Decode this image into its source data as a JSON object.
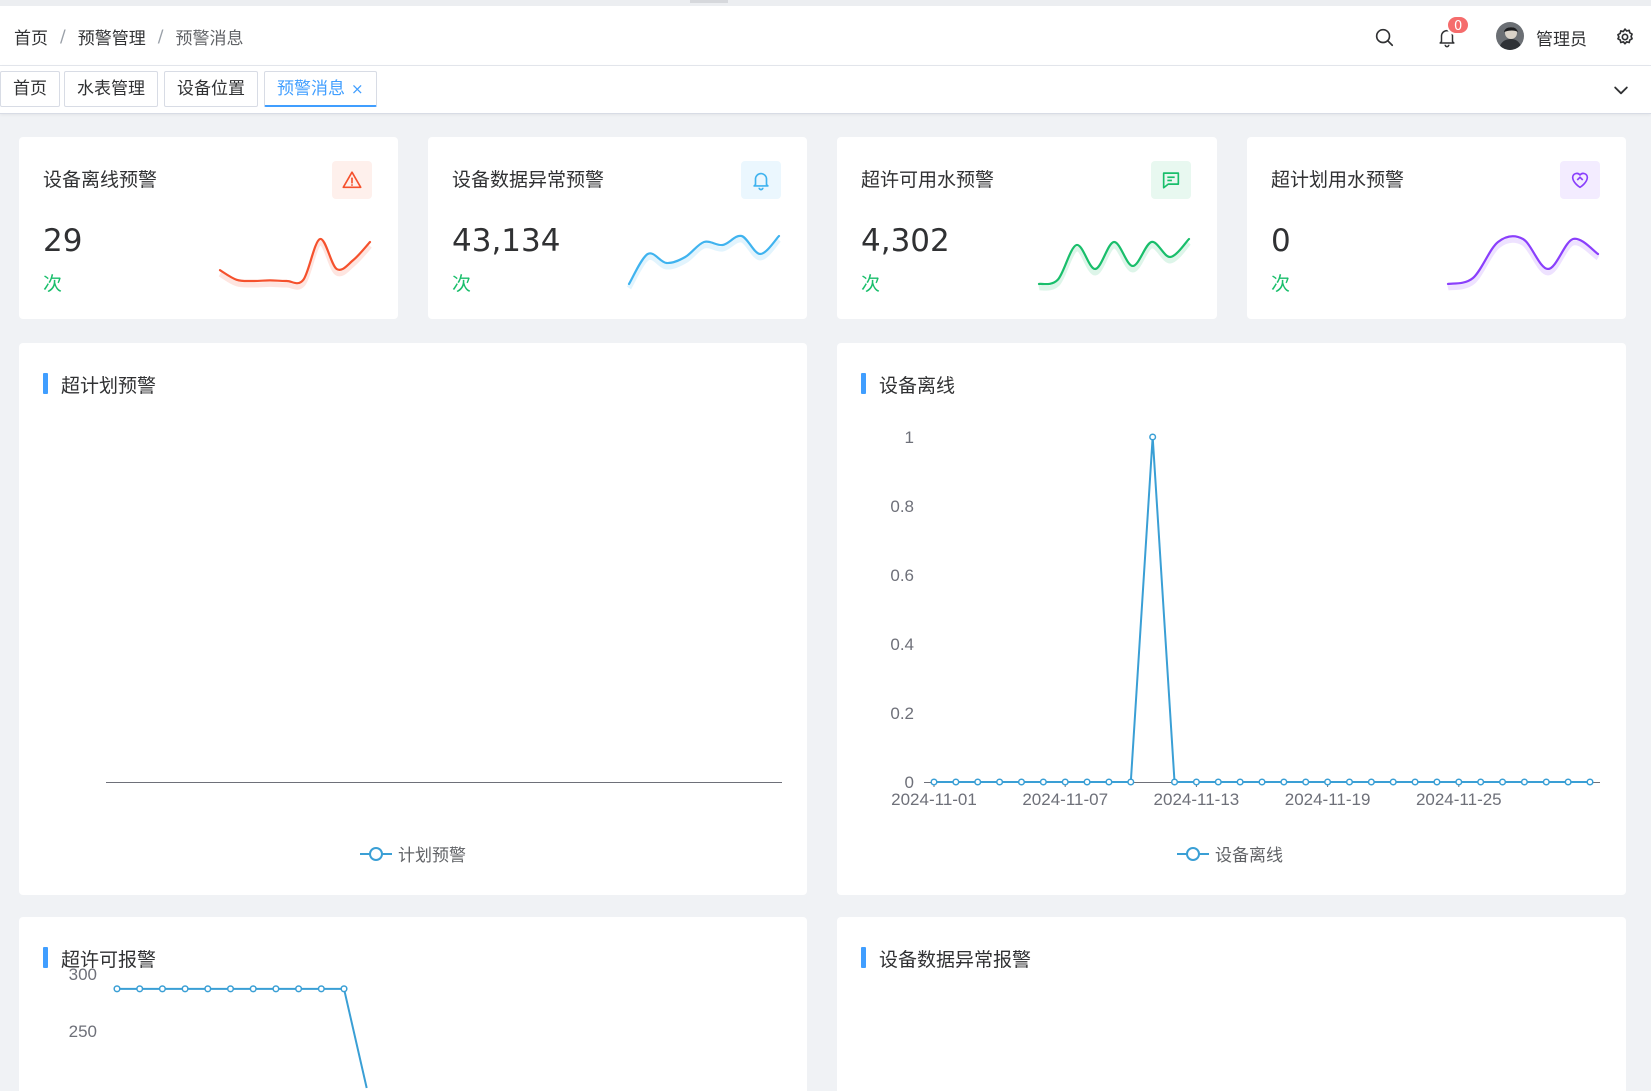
{
  "breadcrumb": [
    "首页",
    "预警管理",
    "预警消息"
  ],
  "header": {
    "notification_count": "0",
    "username": "管理员"
  },
  "tabs": [
    {
      "label": "首页",
      "active": false
    },
    {
      "label": "水表管理",
      "active": false
    },
    {
      "label": "设备位置",
      "active": false
    },
    {
      "label": "预警消息",
      "active": true
    }
  ],
  "tab_close_glyph": "×",
  "stats": [
    {
      "title": "设备离线预警",
      "value": "29",
      "unit": "次",
      "icon": "warning-triangle-icon",
      "color": "#f5512d",
      "bg": "#fef0ec"
    },
    {
      "title": "设备数据异常预警",
      "value": "43,134",
      "unit": "次",
      "icon": "bell-icon",
      "color": "#3fb3ef",
      "bg": "#ebf7fe"
    },
    {
      "title": "超许可用水预警",
      "value": "4,302",
      "unit": "次",
      "icon": "message-icon",
      "color": "#19be6b",
      "bg": "#e8f8f0"
    },
    {
      "title": "超计划用水预警",
      "value": "0",
      "unit": "次",
      "icon": "heart-link-icon",
      "color": "#8a3ffc",
      "bg": "#f3ecff"
    }
  ],
  "panels": {
    "plan": {
      "title": "超计划预警",
      "legend": "计划预警"
    },
    "offline": {
      "title": "设备离线",
      "legend": "设备离线"
    },
    "permit": {
      "title": "超许可报警"
    },
    "anomaly": {
      "title": "设备数据异常报警"
    }
  },
  "chart_data": [
    {
      "type": "line",
      "title": "超计划预警",
      "series": [
        {
          "name": "计划预警",
          "values": []
        }
      ],
      "x": [],
      "legend": "bottom-center"
    },
    {
      "type": "line",
      "title": "设备离线",
      "x": [
        "2024-11-01",
        "2024-11-02",
        "2024-11-03",
        "2024-11-04",
        "2024-11-05",
        "2024-11-06",
        "2024-11-07",
        "2024-11-08",
        "2024-11-09",
        "2024-11-10",
        "2024-11-11",
        "2024-11-12",
        "2024-11-13",
        "2024-11-14",
        "2024-11-15",
        "2024-11-16",
        "2024-11-17",
        "2024-11-18",
        "2024-11-19",
        "2024-11-20",
        "2024-11-21",
        "2024-11-22",
        "2024-11-23",
        "2024-11-24",
        "2024-11-25",
        "2024-11-26",
        "2024-11-27",
        "2024-11-28",
        "2024-11-29",
        "2024-11-30",
        "2024-12-01"
      ],
      "x_tick_labels": [
        "2024-11-01",
        "2024-11-07",
        "2024-11-13",
        "2024-11-19",
        "2024-11-25"
      ],
      "series": [
        {
          "name": "设备离线",
          "values": [
            0,
            0,
            0,
            0,
            0,
            0,
            0,
            0,
            0,
            0,
            1,
            0,
            0,
            0,
            0,
            0,
            0,
            0,
            0,
            0,
            0,
            0,
            0,
            0,
            0,
            0,
            0,
            0,
            0,
            0,
            0
          ]
        }
      ],
      "y_ticks": [
        "0",
        "0.2",
        "0.4",
        "0.6",
        "0.8",
        "1"
      ],
      "ylim": [
        0,
        1
      ],
      "legend": "bottom-center"
    },
    {
      "type": "line",
      "title": "超许可报警",
      "series": [
        {
          "values": [
            287,
            287,
            287,
            287,
            287,
            287,
            287,
            287,
            287,
            287,
            287,
            200
          ]
        }
      ],
      "y_ticks": [
        "250",
        "300"
      ],
      "ylim": [
        200,
        300
      ]
    }
  ],
  "sparklines": [
    {
      "color": "#f5512d",
      "values": [
        0.28,
        0.12,
        0.1,
        0.11,
        0.1,
        0.12,
        0.8,
        0.3,
        0.45,
        0.75
      ]
    },
    {
      "color": "#3fb3ef",
      "values": [
        0.05,
        0.55,
        0.4,
        0.5,
        0.75,
        0.7,
        0.85,
        0.55,
        0.85
      ]
    },
    {
      "color": "#19be6b",
      "values": [
        0.05,
        0.12,
        0.7,
        0.3,
        0.75,
        0.35,
        0.75,
        0.5,
        0.8
      ]
    },
    {
      "color": "#8a3ffc",
      "values": [
        0.05,
        0.15,
        0.75,
        0.8,
        0.3,
        0.8,
        0.55
      ]
    }
  ]
}
